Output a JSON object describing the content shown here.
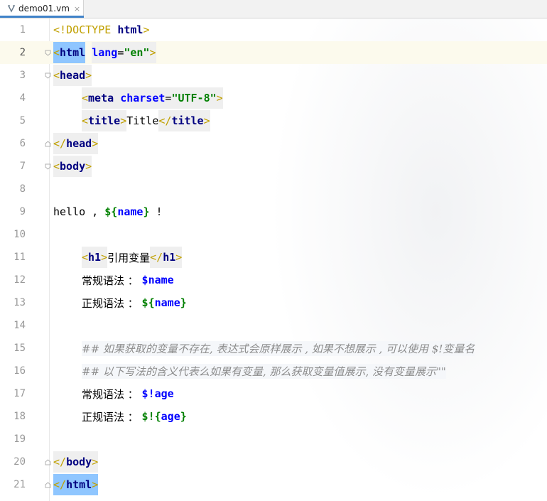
{
  "tab": {
    "filename": "demo01.vm",
    "close": "×"
  },
  "lines": [
    {
      "n": "1"
    },
    {
      "n": "2"
    },
    {
      "n": "3"
    },
    {
      "n": "4"
    },
    {
      "n": "5"
    },
    {
      "n": "6"
    },
    {
      "n": "7"
    },
    {
      "n": "8"
    },
    {
      "n": "9"
    },
    {
      "n": "10"
    },
    {
      "n": "11"
    },
    {
      "n": "12"
    },
    {
      "n": "13"
    },
    {
      "n": "14"
    },
    {
      "n": "15"
    },
    {
      "n": "16"
    },
    {
      "n": "17"
    },
    {
      "n": "18"
    },
    {
      "n": "19"
    },
    {
      "n": "20"
    },
    {
      "n": "21"
    }
  ],
  "code": {
    "l1": {
      "lt": "<",
      "doctype": "!DOCTYPE",
      "html": "html",
      "gt": ">"
    },
    "l2": {
      "lt": "<",
      "tag": "html",
      "attr": "lang",
      "eq": "=",
      "val": "\"en\"",
      "gt": ">"
    },
    "l3": {
      "lt": "<",
      "tag": "head",
      "gt": ">"
    },
    "l4": {
      "lt": "<",
      "tag": "meta",
      "attr": "charset",
      "eq": "=",
      "val": "\"UTF-8\"",
      "gt": ">"
    },
    "l5": {
      "lt": "<",
      "tag": "title",
      "gt": ">",
      "text": "Title",
      "lt2": "</",
      "tag2": "title",
      "gt2": ">"
    },
    "l6": {
      "lt": "</",
      "tag": "head",
      "gt": ">"
    },
    "l7": {
      "lt": "<",
      "tag": "body",
      "gt": ">"
    },
    "l9": {
      "text": "hello , ",
      "dollar": "$",
      "lbrace": "{",
      "name": "name",
      "rbrace": "}",
      "end": " !"
    },
    "l11": {
      "lt": "<",
      "tag": "h1",
      "gt": ">",
      "text": "引用变量",
      "lt2": "</",
      "tag2": "h1",
      "gt2": ">"
    },
    "l12": {
      "label": "常规语法 ： ",
      "var": "$name"
    },
    "l13": {
      "label": "正规语法 ： ",
      "dollar": "$",
      "lbrace": "{",
      "name": "name",
      "rbrace": "}"
    },
    "l15": {
      "comment": "## 如果获取的变量不存在, 表达式会原样展示 , 如果不想展示 , 可以使用 $!变量名"
    },
    "l16": {
      "comment": "## 以下写法的含义代表么如果有变量, 那么获取变量值展示, 没有变量展示\"\""
    },
    "l17": {
      "label": "常规语法 ： ",
      "var": "$!age"
    },
    "l18": {
      "label": "正规语法 ： ",
      "dollar": "$!",
      "lbrace": "{",
      "name": "age",
      "rbrace": "}"
    },
    "l20": {
      "lt": "</",
      "tag": "body",
      "gt": ">"
    },
    "l21": {
      "lt": "</",
      "tag": "html",
      "gt": ">"
    }
  },
  "colors": {
    "current_line": "#fcfaed",
    "tag_highlight": "#8fc6ff",
    "tag_name": "#000080",
    "attr_value": "#008000",
    "comment": "#8c8c8c"
  }
}
